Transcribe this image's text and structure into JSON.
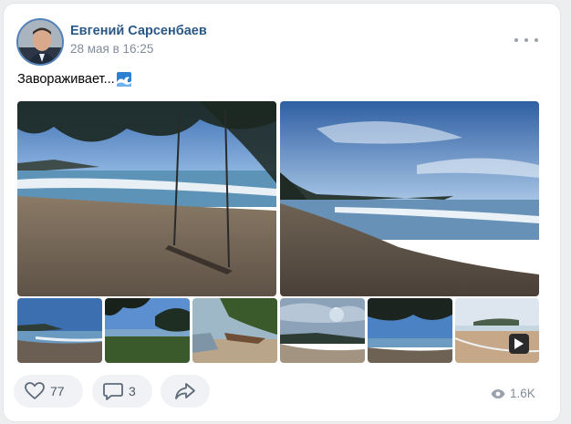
{
  "post": {
    "author": "Евгений Сарсенбаев",
    "date": "28 мая в 16:25",
    "text": "Завораживает...",
    "text_emoji": "wave-emoji"
  },
  "actions": {
    "likes": "77",
    "comments": "3",
    "views": "1.6K"
  },
  "icons": [
    "more-icon",
    "like-icon",
    "comment-icon",
    "share-icon",
    "views-icon",
    "play-icon"
  ],
  "colors": {
    "accent": "#2a5885",
    "meta": "#818c99",
    "button_bg": "#f0f2f5",
    "page_bg": "#edeef0"
  }
}
